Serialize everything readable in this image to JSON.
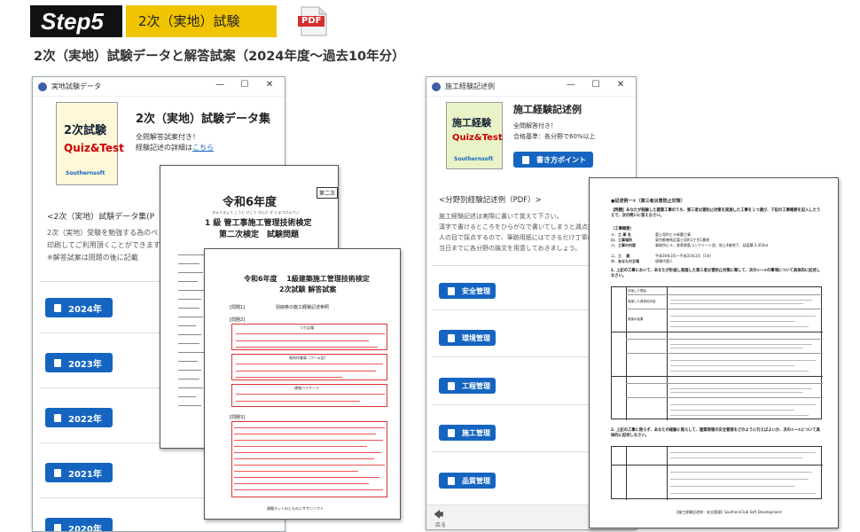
{
  "header": {
    "step_label": "Step5",
    "step_title": "2次（実地）試験",
    "pdf_label": "PDF",
    "main_heading": "2次（実地）試験データと解答試案（2024年度～過去10年分）"
  },
  "left_window": {
    "title": "実地試験データ",
    "controls": [
      "—",
      "☐",
      "✕"
    ],
    "cover": {
      "line1": "2次試験",
      "line2": "Quiz&Test",
      "brand": "Southernsoft"
    },
    "app_title": "2次（実地）試験データ集",
    "desc_line1": "全問解答試案付き！",
    "desc_line2_prefix": "経験記述の詳細は",
    "desc_link": "こちら",
    "section_heading": "<2次（実地）試験データ集(P",
    "body_line1": "2次（実地）受験を勉強する為のペ",
    "body_line2": "印刷してご利用頂くことができます",
    "body_line3": "※解答試案は問題の後に記載",
    "years": [
      "2024年",
      "2023年",
      "2022年",
      "2021年",
      "2020年"
    ]
  },
  "exam_doc": {
    "title": "令和6年度",
    "badge": "第二次",
    "ruby": "きゅうきょう こうじ せこう かんり ぎ じゅつけんてい",
    "sub1": "1 級 管工事施工管理技術検定",
    "sub2": "第二次検定　試験問題"
  },
  "answer_doc": {
    "title1": "令和6年度　 1級建築施工管理技術検定",
    "title2": "2次試験  解答試案",
    "q1": "[問題1]",
    "q1_note": "別冊参の施工経験記述参照",
    "q2": "[問題2]",
    "sec1": "つり足場",
    "sec2": "高所作業車（ブーム型）",
    "sec3": "建物バリケード",
    "q3": "[問題3]",
    "footer": "建築ネットのとものジサザンソフト"
  },
  "right_window": {
    "title": "施工経験記述例",
    "controls": [
      "—",
      "☐",
      "✕"
    ],
    "cover": {
      "line1": "施工経験",
      "line2": "Quiz&Test",
      "brand": "Southernsoft"
    },
    "app_title": "施工経験記述例",
    "desc_line1": "全問解答付き！",
    "desc_line2": "合格基準：各分野で60%以上",
    "howto_button": "書き方ポイント",
    "section_heading": "<分野別経験記述例（PDF）>",
    "body_line1": "施工経験記述は実際に書いて覚えて下さい。",
    "body_line2": "漢字で書けるところをひらがなで書いてしまうと減点対",
    "body_line3": "人の目で採点するので、筆跡用紙にはできるだけ丁寧に",
    "body_line4": "当日までに各分野の論文を用意しておきましょう。",
    "categories": [
      "安全管理",
      "環境管理",
      "工程管理",
      "施工管理",
      "品質管理"
    ],
    "back_label": "戻る"
  },
  "essay_doc": {
    "heading": "●記述例一①（第三者災害防止対策）",
    "question": "【問題】あなたが経験した建築工事のうち、第三者災害防止対策を実施した工事を１つ選び、下記の工事概要を記入したうえで、次の問いに答えなさい。",
    "overview_label": "〔工事概要〕",
    "overview_rows": [
      [
        "イ．工 事 名",
        "富士見町ビル新築工事"
      ],
      [
        "ロ．工事場所",
        "東京都練馬区富士見町1丁目1番地"
      ],
      [
        "ハ．工事の内容",
        "事務所ビル、鉄骨鉄筋コンクリート造、地上4階地下、延面積 2,450㎡"
      ],
      [
        "ニ．工　 期",
        "平成30年3月～平成31年3月（1年）"
      ],
      [
        "ホ．あなたの立場",
        "現場代理人"
      ]
    ],
    "q1_text": "1. 上記の工事において、あなたが計画し実施した第三者災害防止対策に関して、次の①～③の事項について具体的に記述しなさい。",
    "q2_text": "2. 上記の工事に限らず、あなたの経験に照らして、建築現場の安全管理をどのように行えばよいか、次の①～②について具体的に記述しなさい。",
    "table_headers": [
      "計画した理由",
      "実施した具体的内容",
      "実施の結果"
    ],
    "footer": "【施工経験記述例：安全管理】SouthernClub Soft Development"
  }
}
